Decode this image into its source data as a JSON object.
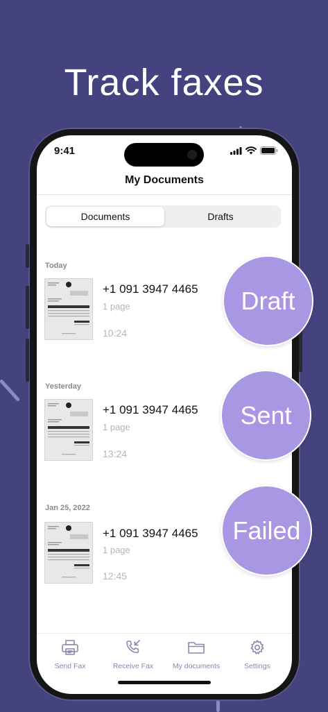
{
  "headline": "Track faxes",
  "status": {
    "time": "9:41"
  },
  "nav": {
    "title": "My Documents"
  },
  "segment": {
    "documents": "Documents",
    "drafts": "Drafts"
  },
  "groups": [
    {
      "label": "Today",
      "number": "+1 091 3947 4465",
      "pages": "1 page",
      "time": "10:24",
      "badge": "Draft"
    },
    {
      "label": "Yesterday",
      "number": "+1 091 3947 4465",
      "pages": "1 page",
      "time": "13:24",
      "badge": "Sent"
    },
    {
      "label": "Jan 25, 2022",
      "number": "+1 091 3947 4465",
      "pages": "1 page",
      "time": "12:45",
      "badge": "Failed"
    }
  ],
  "tabs": [
    {
      "label": "Send Fax",
      "icon": "printer-icon"
    },
    {
      "label": "Receive Fax",
      "icon": "phone-incoming-icon"
    },
    {
      "label": "My documents",
      "icon": "folder-icon"
    },
    {
      "label": "Settings",
      "icon": "gear-icon"
    }
  ],
  "colors": {
    "background": "#45437f",
    "badge": "#a897e2",
    "tab_icon": "#8a86ad"
  }
}
